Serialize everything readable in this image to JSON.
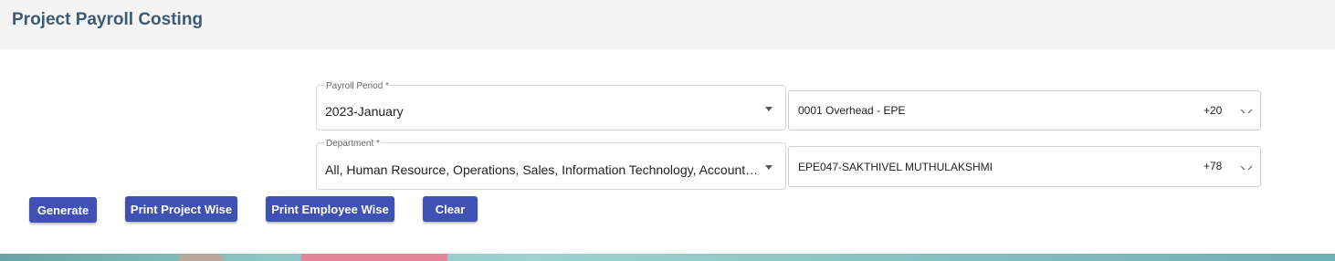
{
  "page": {
    "title": "Project Payroll Costing"
  },
  "form": {
    "payroll_period": {
      "label": "Payroll Period *",
      "value": "2023-January"
    },
    "department": {
      "label": "Department *",
      "value": "All, Human Resource, Operations, Sales, Information Technology, Accounts,..."
    },
    "project_select": {
      "value": "0001 Overhead - EPE",
      "count": "+20"
    },
    "employee_select": {
      "value": "EPE047-SAKTHIVEL MUTHULAKSHMI",
      "count": "+78"
    }
  },
  "actions": {
    "generate": "Generate",
    "print_project_wise": "Print Project Wise",
    "print_employee_wise": "Print Employee Wise",
    "clear": "Clear"
  },
  "colors": {
    "header_bg": "#f4f4f4",
    "title": "#3c5a73",
    "button": "#3f51b5"
  },
  "icons": {
    "dropdown": "caret-down-icon",
    "multiselect": "chevron-down-icon"
  }
}
